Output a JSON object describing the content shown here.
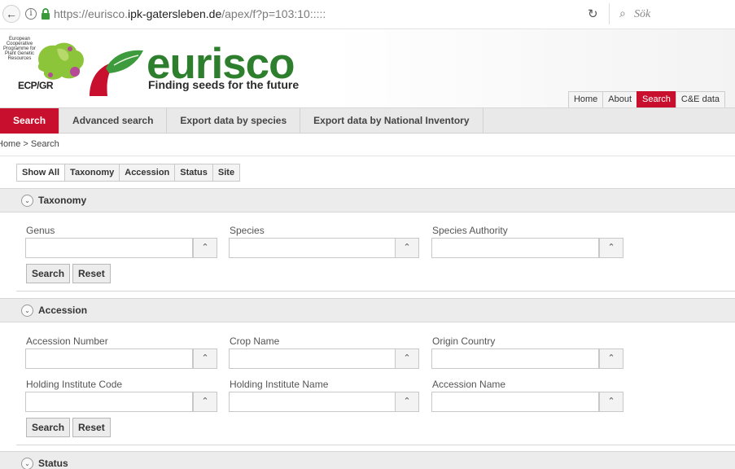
{
  "browser": {
    "url_prefix": "https://eurisco.",
    "url_host": "ipk-gatersleben.de",
    "url_path": "/apex/f?p=103:10:::::",
    "search_placeholder": "Sök"
  },
  "header": {
    "ecp_text": "European Cooperative Programme for Plant Genetic Resources",
    "ecp_label": "ECP/GR",
    "brand": "eurisco",
    "tagline": "Finding seeds for the future",
    "nav": [
      "Home",
      "About",
      "Search",
      "C&E data"
    ]
  },
  "tabs": [
    "Search",
    "Advanced search",
    "Export data by species",
    "Export data by National Inventory"
  ],
  "breadcrumb": "Home  >  Search",
  "subtabs": [
    "Show All",
    "Taxonomy",
    "Accession",
    "Status",
    "Site"
  ],
  "taxonomy": {
    "title": "Taxonomy",
    "fields": [
      "Genus",
      "Species",
      "Species Authority"
    ],
    "search_label": "Search",
    "reset_label": "Reset"
  },
  "accession": {
    "title": "Accession",
    "fields_row1": [
      "Accession Number",
      "Crop Name",
      "Origin Country"
    ],
    "fields_row2": [
      "Holding Institute Code",
      "Holding Institute Name",
      "Accession Name"
    ],
    "search_label": "Search",
    "reset_label": "Reset"
  },
  "status": {
    "title": "Status"
  },
  "colors": {
    "accent": "#c8102e",
    "brand_green": "#2d7f2d"
  },
  "icons": {
    "back": "arrow-left",
    "info": "info-circle",
    "lock": "padlock",
    "reload": "reload",
    "search": "magnifier",
    "toggle": "chevron-down-circle",
    "lov": "chevron-up"
  }
}
